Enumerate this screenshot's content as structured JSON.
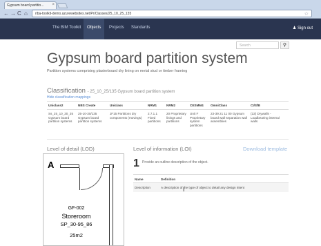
{
  "browser": {
    "tab_title": "Gypsum board partitio...",
    "tab_close": "×",
    "nav_back": "←",
    "nav_forward": "→",
    "nav_reload": "C",
    "nav_home": "⌂",
    "url": "riba-toolkit-demo.azurewebsites.net/Pr/Classes/25_10_25_135",
    "star_icon": "☆"
  },
  "navbar": {
    "brand": "The BIM Toolkit",
    "items": [
      "Objects",
      "Projects",
      "Standards"
    ],
    "active_item": "Objects",
    "signout": "Sign out",
    "user_icon": "person-icon"
  },
  "search": {
    "placeholder": "Search",
    "button_icon": "🔍"
  },
  "page": {
    "title": "Gypsum board partition system",
    "subtitle": "Partition systems comprising plasterboard dry lining on metal stud or timber framing"
  },
  "classification": {
    "heading": "Classification",
    "code": "25_10_25/135 Gypsum board partition system",
    "hide_link": "Hide classification mappings",
    "columns": [
      "Uniclass2",
      "NBS Create",
      "Uniclass",
      "NRM1",
      "NRM2",
      "CESMM4",
      "OmniClass",
      "CI/SfB"
    ],
    "row": [
      "Ss_25_10_30_35 Gypsum board partition systems",
      "25-10-30/135 Gypsum board partition systems",
      "JF15 Partitions dry components (movings)",
      "2.7.1.1 Fixed partitions",
      "20 Proprietary linings and partitions",
      "Unit F Proprietary system partitions",
      "23-39 21 11 00 Gypsum board wall separation wall assemblies",
      "(22) Drywalls - Loadbearing internal walls"
    ]
  },
  "lod": {
    "heading": "Level of detail (LOD)",
    "label": "A",
    "room_code": "GF-002",
    "room_name": "Storeroom",
    "room_ref": "SP_30-95_86",
    "room_area": "25m2"
  },
  "loi": {
    "heading": "Level of information (LOI)",
    "download_label": "Download template",
    "step_number": "1",
    "step_text": "Provide an outline description of the object.",
    "table_headers": [
      "Name",
      "Definition"
    ],
    "rows": [
      {
        "name": "Description",
        "definition": "A description of the type of object to detail any design intent"
      }
    ]
  },
  "colors": {
    "navbar": "#2a3550",
    "accent": "#5a8fd6"
  }
}
